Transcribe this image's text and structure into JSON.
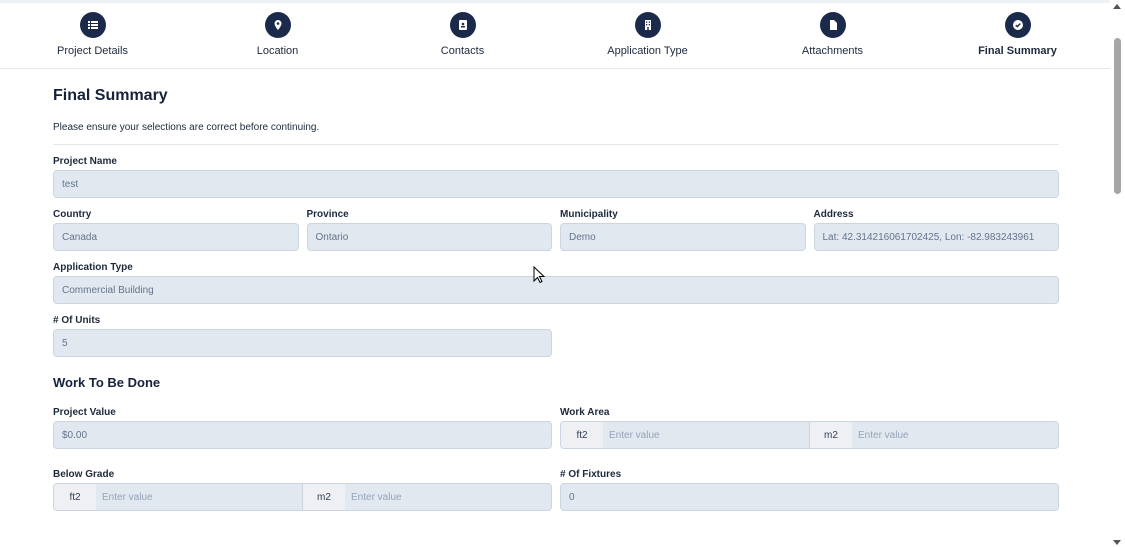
{
  "steps": [
    {
      "label": "Project Details",
      "icon": "list-icon"
    },
    {
      "label": "Location",
      "icon": "map-pin-icon"
    },
    {
      "label": "Contacts",
      "icon": "contact-book-icon"
    },
    {
      "label": "Application Type",
      "icon": "building-icon"
    },
    {
      "label": "Attachments",
      "icon": "file-icon"
    },
    {
      "label": "Final Summary",
      "icon": "check-circle-icon",
      "active": true
    }
  ],
  "title": "Final Summary",
  "subtitle": "Please ensure your selections are correct before continuing.",
  "fields": {
    "project_name": {
      "label": "Project Name",
      "value": "test"
    },
    "country": {
      "label": "Country",
      "value": "Canada"
    },
    "province": {
      "label": "Province",
      "value": "Ontario"
    },
    "municipality": {
      "label": "Municipality",
      "value": "Demo"
    },
    "address": {
      "label": "Address",
      "value": "Lat: 42.314216061702425, Lon: -82.983243961"
    },
    "application_type": {
      "label": "Application Type",
      "value": "Commercial Building"
    },
    "units": {
      "label": "# Of Units",
      "value": "5"
    }
  },
  "work": {
    "heading": "Work To Be Done",
    "project_value": {
      "label": "Project Value",
      "value": "$0.00"
    },
    "work_area": {
      "label": "Work Area",
      "unit1": "ft2",
      "unit2": "m2",
      "placeholder": "Enter value"
    },
    "below_grade": {
      "label": "Below Grade",
      "unit1": "ft2",
      "unit2": "m2",
      "placeholder": "Enter value"
    },
    "fixtures": {
      "label": "# Of Fixtures",
      "value": "0"
    }
  },
  "colors": {
    "accent": "#1b2a4a",
    "input_bg": "#e2e8f0"
  }
}
